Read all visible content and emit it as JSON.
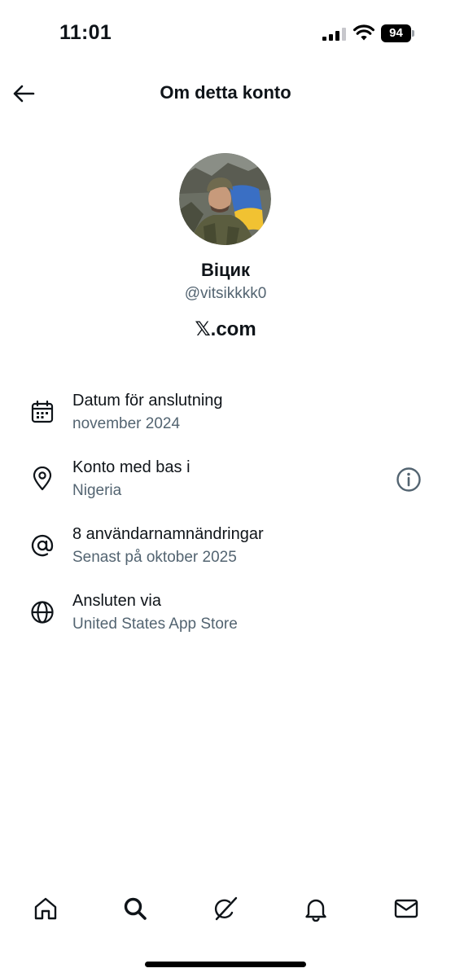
{
  "status_bar": {
    "time": "11:01",
    "battery_level": "94",
    "signal_bars_active": 3,
    "signal_bars_total": 4
  },
  "header": {
    "title": "Om detta konto",
    "back_icon": "arrow-left-icon"
  },
  "profile": {
    "name": "Віцик",
    "handle": "@vitsikkkk0",
    "site": "𝕏.com"
  },
  "info_rows": [
    {
      "icon": "calendar-icon",
      "title": "Datum för anslutning",
      "subtitle": "november 2024"
    },
    {
      "icon": "location-pin-icon",
      "title": "Konto med bas i",
      "subtitle": "Nigeria",
      "action_icon": "info-circle-icon"
    },
    {
      "icon": "at-sign-icon",
      "title": "8 användarnamnändringar",
      "subtitle": "Senast på oktober 2025"
    },
    {
      "icon": "globe-icon",
      "title": "Ansluten via",
      "subtitle": "United States App Store"
    }
  ],
  "bottom_nav": [
    {
      "icon": "home-icon"
    },
    {
      "icon": "search-icon",
      "active": true
    },
    {
      "icon": "grok-icon"
    },
    {
      "icon": "bell-icon"
    },
    {
      "icon": "mail-icon"
    }
  ],
  "colors": {
    "text_primary": "#0f1419",
    "text_secondary": "#536471",
    "background": "#ffffff"
  }
}
